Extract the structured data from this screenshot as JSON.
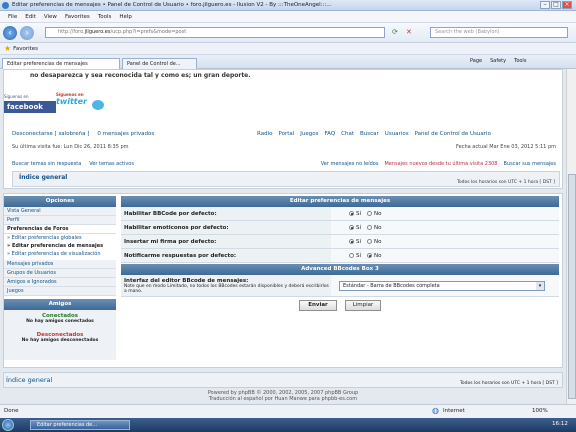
{
  "window": {
    "title": "Editar preferencias de mensajes • Panel de Control de Usuario • foro.jilguero.es - Ilusion V2 - By :::TheOneAngel:::..."
  },
  "menu": [
    "File",
    "Edit",
    "View",
    "Favorites",
    "Tools",
    "Help"
  ],
  "address": {
    "prefix": "http://foro.",
    "domain": "jilguero.es",
    "rest": "/ucp.php?i=prefs&mode=post",
    "search_placeholder": "Search the web (Babylon)"
  },
  "favorites": {
    "label": "Favorites"
  },
  "tabs": [
    {
      "label": "Editar preferencias de mensajes"
    },
    {
      "label": "Panel de Control de..."
    }
  ],
  "toolbar_right": [
    "Page",
    "Safety",
    "Tools"
  ],
  "page": {
    "banner_text": "no desaparezca y sea reconocida tal y como es; un gran deporte.",
    "social": {
      "fb_top": "Síguenos en",
      "fb_logo": "facebook",
      "tw_top": "Síguenos en",
      "tw_logo": "twitter"
    },
    "logout": "Desconectarse [ salobreña ]",
    "pm": "0 mensajes privados",
    "nav_links": [
      "Radio",
      "Portal",
      "Juegos",
      "FAQ",
      "Chat",
      "Buscar",
      "Usuarios",
      "Panel de Control de Usuario"
    ],
    "last_visit": "Su última visita fue: Lun Dic 26, 2011 8:35 pm",
    "current_date": "Fecha actual Mar Ene 03, 2012 5:11 pm",
    "search_links": [
      "Buscar temas sin respuesta",
      "Ver temas activos"
    ],
    "read_links": [
      "Ver mensajes no leídos",
      "Mensajes nuevos desde tu última visita 2308",
      "Buscar sus mensajes"
    ],
    "breadcrumb": "Índice general",
    "timezone": "Todos los horarios son UTC + 1 hora [ DST ]"
  },
  "sidebar": {
    "options_header": "Opciones",
    "items": [
      "Vista General",
      "Perfil"
    ],
    "forums_title": "Preferencias de Foros",
    "forum_subs": [
      "» Editar preferencias globales",
      "» Editar preferencias de mensajes",
      "» Editar preferencias de visualización"
    ],
    "bottom_items": [
      "Mensajes privados",
      "Grupos de Usuarios",
      "Amigos e Ignorados",
      "Juegos"
    ],
    "friends_header": "Amigos",
    "connected": "Conectados",
    "no_connected": "No hay amigos conectados",
    "disconnected": "Desconectados",
    "no_disconnected": "No hay amigos desconectados"
  },
  "form": {
    "header": "Editar preferencias de mensajes",
    "rows": [
      {
        "label": "Habilitar BBCode por defecto:",
        "yes": "Sí",
        "no": "No",
        "selected": "yes"
      },
      {
        "label": "Habilitar emoticonos por defecto:",
        "yes": "Sí",
        "no": "No",
        "selected": "yes"
      },
      {
        "label": "Insertar mi firma por defecto:",
        "yes": "Sí",
        "no": "No",
        "selected": "yes"
      },
      {
        "label": "Notificarme respuestas por defecto:",
        "yes": "Sí",
        "no": "No",
        "selected": "no"
      }
    ],
    "bbcode_header": "Advanced BBcodes Box 3",
    "iface_label": "Interfaz del editor BBcode de mensajes:",
    "iface_note": "Note que en modo Limitado, no todos los BBcodes estarán disponibles y deberá escribirlos a mano.",
    "iface_value": "Estándar - Barra de BBcodes completa",
    "submit": "Enviar",
    "reset": "Limpiar"
  },
  "footer": {
    "breadcrumb": "Índice general",
    "timezone": "Todos los horarios son UTC + 1 hora [ DST ]",
    "powered": "Powered by phpBB © 2000, 2002, 2005, 2007 phpBB Group",
    "translation": "Traducción al español por Huan Manwe para phpbb-es.com"
  },
  "status": {
    "left": "Done",
    "zone": "Internet",
    "zoom": "100%"
  },
  "taskbar": {
    "item": "Editar preferencias de...",
    "clock": "16:12"
  }
}
